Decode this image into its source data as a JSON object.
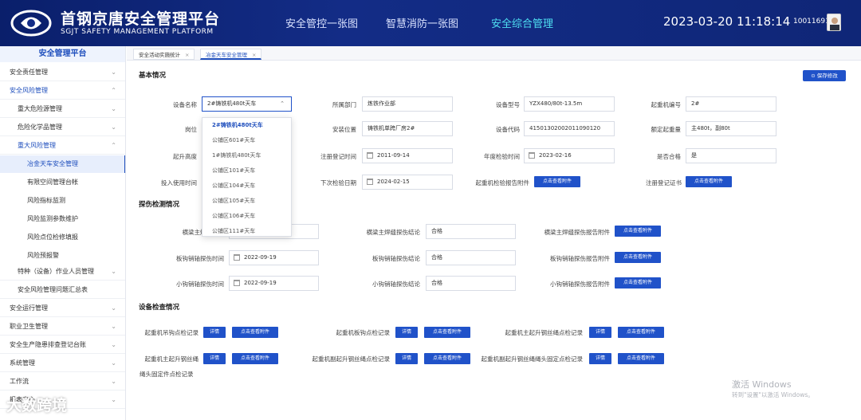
{
  "header": {
    "title": "首钢京唐安全管理平台",
    "subtitle": "SGJT SAFETY MANAGEMENT PLATFORM",
    "nav": [
      "安全管控一张图",
      "智慧消防一张图",
      "安全综合管理"
    ],
    "active_nav": "安全综合管理",
    "datetime": "2023-03-20 11:18:14",
    "user_id": "10011691"
  },
  "sidebar": {
    "title": "安全管理平台",
    "items": [
      {
        "label": "安全责任管理",
        "chevron": "⌄"
      },
      {
        "label": "安全风险管理",
        "chevron": "⌃"
      },
      {
        "label": "重大危险源管理",
        "chevron": "⌄"
      },
      {
        "label": "危险化学品管理",
        "chevron": "⌄"
      },
      {
        "label": "重大风险管理",
        "chevron": "⌃"
      },
      {
        "label": "冶金天车安全管理"
      },
      {
        "label": "有限空间管理台帐"
      },
      {
        "label": "风险指标监测"
      },
      {
        "label": "风险监测参数维护"
      },
      {
        "label": "风险点位检修填报"
      },
      {
        "label": "风险预报警"
      },
      {
        "label": "特种（设备）作业人员管理",
        "chevron": "⌄"
      },
      {
        "label": "安全风险管理问题汇总表"
      },
      {
        "label": "安全运行管理",
        "chevron": "⌄"
      },
      {
        "label": "职业卫生管理",
        "chevron": "⌄"
      },
      {
        "label": "安全生产隐患排查登记台账",
        "chevron": "⌄"
      },
      {
        "label": "系统管理",
        "chevron": "⌄"
      },
      {
        "label": "工作流",
        "chevron": "⌄"
      },
      {
        "label": "报表中心",
        "chevron": "⌄"
      }
    ]
  },
  "tabs": [
    {
      "label": "安全活动实施统计",
      "close": "×"
    },
    {
      "label": "冶金天车安全管理",
      "close": "×"
    }
  ],
  "save_button": "保存修改",
  "basic": {
    "title": "基本情况",
    "device_name_label": "设备名称",
    "device_name_value": "2#铸铁机480t天车",
    "dept_label": "所属部门",
    "dept_value": "炼铁作业部",
    "model_label": "设备型号",
    "model_value": "YZX480/80t-13.5m",
    "crane_no_label": "起重机编号",
    "crane_no_value": "2#",
    "post_label": "岗位",
    "location_label": "安装位置",
    "location_value": "铸铁机单跨厂房2#",
    "code_label": "设备代码",
    "code_value": "4150130200201109012​0",
    "rated_label": "额定起重量",
    "rated_value": "主480t，副80t",
    "height_label": "起升高度",
    "reg_time_label": "注册登记时间",
    "reg_time_value": "2011-09-14",
    "annual_label": "年度检验时间",
    "annual_value": "2023-02-16",
    "qualified_label": "是否合格",
    "qualified_value": "是",
    "use_time_label": "投入使用时间",
    "next_check_label": "下次检验日期",
    "next_check_value": "2024-02-15",
    "report_attach_label": "起重机检验报告附件",
    "reg_cert_label": "注册登记证书",
    "view_attach": "点击查看附件"
  },
  "dropdown": {
    "options": [
      "2#铸铁机480t天车",
      "公铺区601#天车",
      "1#铸铁机480t天车",
      "公铺区101#天车",
      "公铺区104#天车",
      "公铺区105#天车",
      "公铺区106#天车",
      "公铺区111#天车"
    ]
  },
  "flaw": {
    "title": "探伤检测情况",
    "row1": {
      "l1": "横梁主焊缝探伤",
      "l2": "横梁主焊缝探伤结论",
      "v2": "合格",
      "l3": "横梁主焊缝探伤报告附件"
    },
    "row2": {
      "l1": "板钩销轴探伤时间",
      "v1": "2022-09-19",
      "l2": "板钩销轴探伤结论",
      "v2": "合格",
      "l3": "板钩销轴探伤报告附件"
    },
    "row3": {
      "l1": "小钩销轴探伤时间",
      "v1": "2022-09-19",
      "l2": "小钩销轴探伤结论",
      "v2": "合格",
      "l3": "小钩销轴探伤报告附件"
    }
  },
  "inspect": {
    "title": "设备检查情况",
    "detail": "详情",
    "r1": [
      "起重机吊钩点检记录",
      "起重机板钩点检记录",
      "起重机主起升钢丝绳点检记录"
    ],
    "r2": [
      "起重机主起升钢丝绳",
      "起重机副起升钢丝绳点检记录",
      "起重机副起升钢丝绳绳头固定点检记录"
    ],
    "r2_extra": "绳头固定件点检记录"
  },
  "watermark": {
    "line1": "激活 Windows",
    "line2": "转到\"设置\"以激活 Windows。"
  },
  "overlay_text": "大数跨境"
}
